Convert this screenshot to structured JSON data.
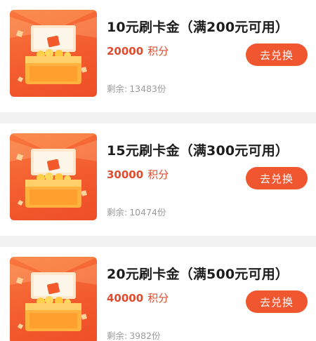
{
  "items": [
    {
      "title": "10元刷卡金（满200元可用）",
      "points_value": "20000",
      "points_unit": "积分",
      "stock_label": "剩余:",
      "stock_value": "13483份",
      "button_label": "去兑换",
      "icon": "treasure-chest-icon"
    },
    {
      "title": "15元刷卡金（满300元可用）",
      "points_value": "30000",
      "points_unit": "积分",
      "stock_label": "剩余:",
      "stock_value": "10474份",
      "button_label": "去兑换",
      "icon": "treasure-chest-icon"
    },
    {
      "title": "20元刷卡金（满500元可用）",
      "points_value": "40000",
      "points_unit": "积分",
      "stock_label": "剩余:",
      "stock_value": "3982份",
      "button_label": "去兑换",
      "icon": "treasure-chest-icon"
    }
  ],
  "colors": {
    "accent": "#f0562f",
    "points": "#e04c2f",
    "muted": "#9a9a9a",
    "background": "#f2f2f2",
    "card": "#ffffff"
  }
}
